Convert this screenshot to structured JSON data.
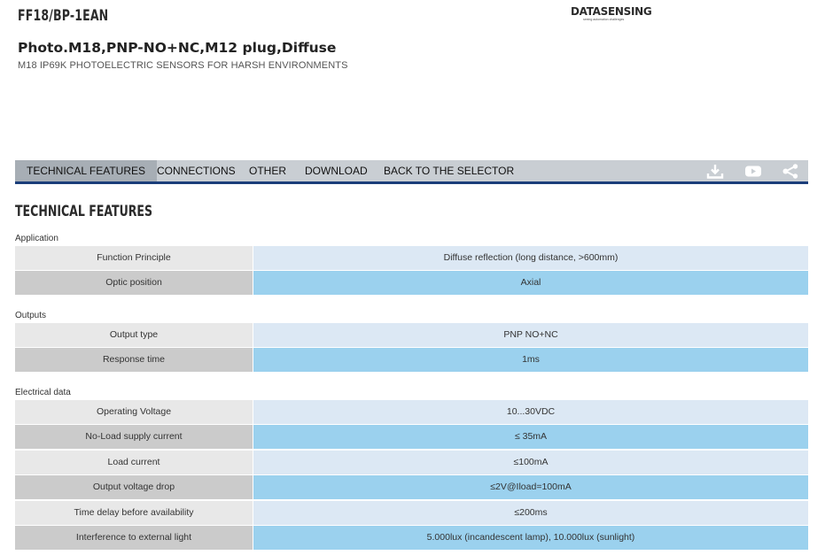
{
  "product": {
    "code": "FF18/BP-1EAN",
    "title": "Photo.M18,PNP-NO+NC,M12 plug,Diffuse",
    "subtitle": "M18 IP69K PHOTOELECTRIC SENSORS FOR HARSH ENVIRONMENTS"
  },
  "brand": {
    "logo_text": "DATASENSING",
    "tagline": "seeing automation challenges"
  },
  "nav": {
    "tabs": [
      "TECHNICAL FEATURES",
      "CONNECTIONS",
      "OTHER",
      "DOWNLOAD",
      "BACK TO THE SELECTOR"
    ],
    "active": "TECHNICAL FEATURES",
    "icons": [
      "download-icon",
      "youtube-icon",
      "share-icon"
    ],
    "colors": {
      "bar": "#c9ced3",
      "active_tab": "#a7aeb5",
      "underline": "#1b3e7a"
    }
  },
  "section": {
    "title": "TECHNICAL FEATURES"
  },
  "groups": [
    {
      "label": "Application",
      "rows": [
        {
          "key": "Function Principle",
          "value": "Diffuse reflection (long distance, >600mm)"
        },
        {
          "key": "Optic position",
          "value": "Axial"
        }
      ]
    },
    {
      "label": "Outputs",
      "rows": [
        {
          "key": "Output type",
          "value": "PNP NO+NC"
        },
        {
          "key": "Response time",
          "value": "1ms"
        }
      ]
    },
    {
      "label": "Electrical data",
      "rows": [
        {
          "key": "Operating Voltage",
          "value": "10...30VDC"
        },
        {
          "key": "No-Load supply current",
          "value": "≤ 35mA"
        },
        {
          "key": "Load current",
          "value": "≤100mA"
        },
        {
          "key": "Output voltage drop",
          "value": "≤2V@Iload=100mA"
        },
        {
          "key": "Time delay before availability",
          "value": "≤200ms"
        },
        {
          "key": "Interference to external light",
          "value": "5.000lux (incandescent lamp), 10.000lux (sunlight)"
        }
      ]
    }
  ]
}
